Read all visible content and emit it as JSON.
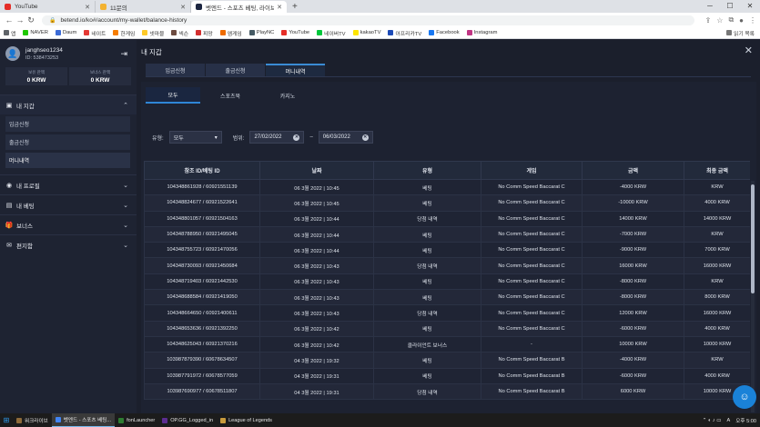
{
  "browser": {
    "tabs": [
      {
        "title": "YouTube",
        "color": "#e52d27"
      },
      {
        "title": "11문의",
        "color": "#f3b230"
      },
      {
        "title": "벳엔드 - 스포츠 베팅, 라이브 카...",
        "color": "#1c2540"
      }
    ],
    "url": "betend.io/ko#/account/my-wallet/balance-history",
    "bookmarks": [
      {
        "label": "앱",
        "color": "#5f6368"
      },
      {
        "label": "NAVER",
        "color": "#1ec800"
      },
      {
        "label": "Daum",
        "color": "#3b6bd6"
      },
      {
        "label": "네이트",
        "color": "#e53935"
      },
      {
        "label": "한게임",
        "color": "#f57c00"
      },
      {
        "label": "넷마블",
        "color": "#ffca28"
      },
      {
        "label": "넥슨",
        "color": "#6d4c41"
      },
      {
        "label": "피망",
        "color": "#d32f2f"
      },
      {
        "label": "엠게임",
        "color": "#ef6c00"
      },
      {
        "label": "PlayNC",
        "color": "#455a64"
      },
      {
        "label": "YouTube",
        "color": "#e52d27"
      },
      {
        "label": "네이버TV",
        "color": "#00c73c"
      },
      {
        "label": "kakaoTV",
        "color": "#fee500"
      },
      {
        "label": "아프리카TV",
        "color": "#1d4bb7"
      },
      {
        "label": "Facebook",
        "color": "#1877f2"
      },
      {
        "label": "Instagram",
        "color": "#c13584"
      }
    ],
    "reading_list": "읽기 목록"
  },
  "sidebar": {
    "username": "janghseo1234",
    "user_id": "ID: 538473253",
    "balances": [
      {
        "label": "보유 잔액",
        "value": "0 KRW"
      },
      {
        "label": "보너스 잔액",
        "value": "0 KRW"
      }
    ],
    "wallet_title": "내 지갑",
    "wallet_items": [
      "입금신청",
      "출금신청",
      "머니내역"
    ],
    "menus": [
      "내 프로필",
      "내 베팅",
      "보너스",
      "편지함"
    ]
  },
  "main": {
    "title": "내 지갑",
    "tabs": [
      "입금신청",
      "출금신청",
      "머니내역"
    ],
    "subtabs": [
      "모두",
      "스포츠북",
      "카지노"
    ],
    "filter": {
      "type_label": "유형:",
      "type_value": "모두",
      "range_label": "범위:",
      "date_from": "27/02/2022",
      "date_to": "06/03/2022",
      "dash": "–"
    },
    "columns": [
      "참조 ID/베팅 ID",
      "날짜",
      "유형",
      "게임",
      "금액",
      "최종 금액"
    ],
    "rows": [
      [
        "104348861928 / 60921551139",
        "06 3월 2022 | 10:45",
        "베팅",
        "No Comm Speed Baccarat C",
        "-4000 KRW",
        "KRW"
      ],
      [
        "104348824677 / 60921522641",
        "06 3월 2022 | 10:45",
        "베팅",
        "No Comm Speed Baccarat C",
        "-10000 KRW",
        "4000 KRW"
      ],
      [
        "104348801057 / 60921504163",
        "06 3월 2022 | 10:44",
        "당첨 내역",
        "No Comm Speed Baccarat C",
        "14000 KRW",
        "14000 KRW"
      ],
      [
        "104348788950 / 60921495045",
        "06 3월 2022 | 10:44",
        "베팅",
        "No Comm Speed Baccarat C",
        "-7000 KRW",
        "KRW"
      ],
      [
        "104348755723 / 60921470056",
        "06 3월 2022 | 10:44",
        "베팅",
        "No Comm Speed Baccarat C",
        "-9000 KRW",
        "7000 KRW"
      ],
      [
        "104348730093 / 60921450684",
        "06 3월 2022 | 10:43",
        "당첨 내역",
        "No Comm Speed Baccarat C",
        "16000 KRW",
        "16000 KRW"
      ],
      [
        "104348719403 / 60921442530",
        "06 3월 2022 | 10:43",
        "베팅",
        "No Comm Speed Baccarat C",
        "-8000 KRW",
        "KRW"
      ],
      [
        "104348688584 / 60921419050",
        "06 3월 2022 | 10:43",
        "베팅",
        "No Comm Speed Baccarat C",
        "-8000 KRW",
        "8000 KRW"
      ],
      [
        "104348664650 / 60921400611",
        "06 3월 2022 | 10:43",
        "당첨 내역",
        "No Comm Speed Baccarat C",
        "12000 KRW",
        "16000 KRW"
      ],
      [
        "104348653636 / 60921392250",
        "06 3월 2022 | 10:42",
        "베팅",
        "No Comm Speed Baccarat C",
        "-6000 KRW",
        "4000 KRW"
      ],
      [
        "104348625043 / 60921370216",
        "06 3월 2022 | 10:42",
        "클라이언트 보너스",
        "-",
        "10000 KRW",
        "10000 KRW"
      ],
      [
        "103987879390 / 60678634507",
        "04 3월 2022 | 19:32",
        "베팅",
        "No Comm Speed Baccarat B",
        "-4000 KRW",
        "KRW"
      ],
      [
        "103987791972 / 60678577059",
        "04 3월 2022 | 19:31",
        "베팅",
        "No Comm Speed Baccarat B",
        "-6000 KRW",
        "4000 KRW"
      ],
      [
        "103987690977 / 60678511807",
        "04 3월 2022 | 19:31",
        "당첨 내역",
        "No Comm Speed Baccarat B",
        "6000 KRW",
        "10000 KRW"
      ]
    ]
  },
  "taskbar": {
    "items": [
      {
        "label": "워크라이브",
        "color": "#8e6b3a"
      },
      {
        "label": "벳엔드 - 스포츠 베팅...",
        "color": "#4285f4"
      },
      {
        "label": "fonLauncher",
        "color": "#2e7d32"
      },
      {
        "label": "OP.GG_Logged_in",
        "color": "#5c2d91"
      },
      {
        "label": "League of Legends",
        "color": "#c89b3c"
      }
    ],
    "lang": "A",
    "clock": "오후 5:00"
  }
}
